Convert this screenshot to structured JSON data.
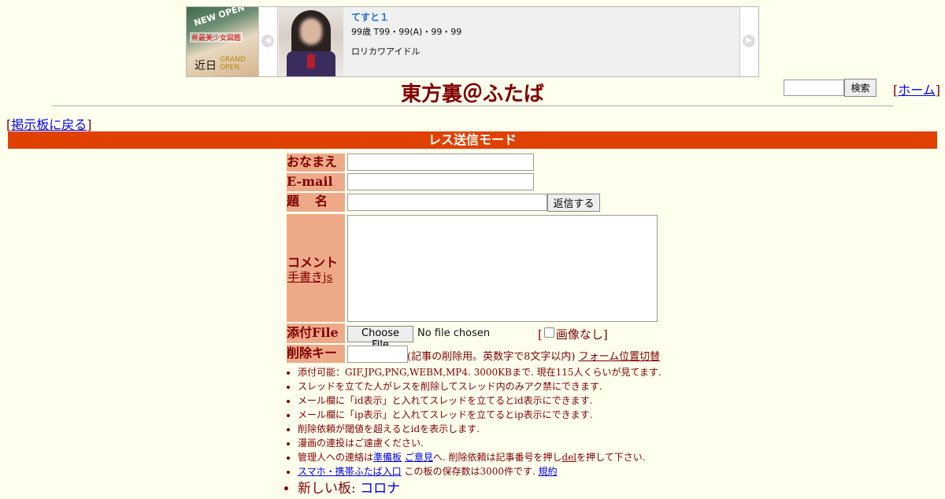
{
  "ad": {
    "banner": {
      "new_open": "NEW OPEN",
      "shop_line": "県最美少女図鑑",
      "soon": "近日",
      "grand_open": "GRAND OPEN"
    },
    "prev_arrow": "◀",
    "next_arrow": "▶",
    "name": "てすと１",
    "stats": "99歳 T99・99(A)・99・99",
    "tagline": "ロリカワアイドル"
  },
  "header": {
    "title": "東方裏＠ふたば",
    "search_button": "検索",
    "home_open": "[",
    "home_link": "ホーム",
    "home_close": "]",
    "back_open": "[",
    "back_link": "掲示板に戻る",
    "back_close": "]"
  },
  "mode_bar": "レス送信モード",
  "form": {
    "name_label": "おなまえ",
    "email_label": "E-mail",
    "subject_label": "題名",
    "reply_button": "返信する",
    "comment_label": "コメント",
    "handwriting_link": "手書きjs",
    "file_label": "添付File",
    "choose_file": "Choose File",
    "file_status": "No file chosen",
    "no_image_open": "[",
    "no_image_label": "画像なし]",
    "delkey_label": "削除キー",
    "delkey_note": "(記事の削除用。英数字で8文字以内)",
    "form_toggle_link": "フォーム位置切替"
  },
  "notes": [
    {
      "text": "添付可能：GIF,JPG,PNG,WEBM,MP4. 3000KBまで. 現在115人くらいが見てます."
    },
    {
      "text": "スレッドを立てた人がレスを削除してスレッド内のみアク禁にできます."
    },
    {
      "text": "メール欄に「id表示」と入れてスレッドを立てるとid表示にできます."
    },
    {
      "text": "メール欄に「ip表示」と入れてスレッドを立てるとip表示にできます."
    },
    {
      "text": "削除依頼が閾値を超えるとidを表示します."
    },
    {
      "text": "漫画の連投はご遠慮ください."
    }
  ],
  "note_admin": {
    "pre": "管理人への連絡は",
    "link1": "準備板",
    "link2": "ご意見",
    "mid": "へ. 削除依頼は記事番号を押し",
    "link3": "del",
    "post": "を押して下さい."
  },
  "note_mobile": {
    "link": "スマホ・携帯ふたば入口",
    "mid": " この板の保存数は3000件です. ",
    "rules_link": "規約"
  },
  "note_new_board": {
    "label": "新しい板: ",
    "link": "コロナ"
  }
}
